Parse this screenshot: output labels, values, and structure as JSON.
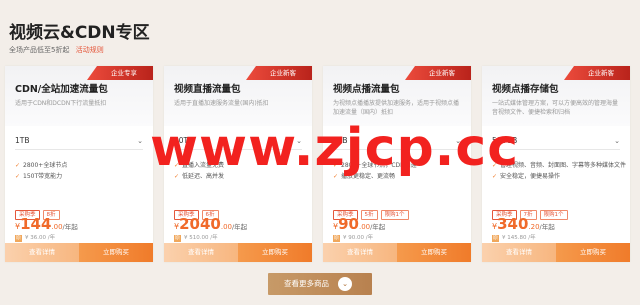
{
  "header": {
    "title": "视频云&CDN专区",
    "subtitle": "全场产品低至5折起",
    "rules_link": "活动规则"
  },
  "cards": [
    {
      "ribbon": "企业专享",
      "title": "CDN/全站加速流量包",
      "desc": "适用于CDN和DCDN下行流量抵扣",
      "spec": "1TB",
      "features": [
        "2800+全球节点",
        "150T带宽能力"
      ],
      "tags": [
        "采购季",
        "8折"
      ],
      "price_int": "144",
      "price_dec": ".00",
      "unit": "/年起",
      "orig_badge": "原",
      "orig": "¥ 36.00 /年",
      "detail_label": "查看详情",
      "buy_label": "立即购买"
    },
    {
      "ribbon": "企业新客",
      "title": "视频直播流量包",
      "desc": "适用于直播加速服务流量(国内)抵扣",
      "spec": "40TB",
      "features": [
        "直播入流量免费",
        "低延迟、高并发"
      ],
      "tags": [
        "采购季",
        "6折"
      ],
      "price_int": "2040",
      "price_dec": ".00",
      "unit": "/年起",
      "orig_badge": "原",
      "orig": "¥ 510.00 /年",
      "detail_label": "查看详情",
      "buy_label": "立即购买"
    },
    {
      "ribbon": "企业新客",
      "title": "视频点播流量包",
      "desc": "为视频点播播放提供加速服务，适用于视频点播加速流量（国内）抵扣",
      "spec": "1TB",
      "features": [
        "2800+全球节点，CDN加速",
        "播放更稳定、更流畅"
      ],
      "tags": [
        "采购季",
        "5折",
        "限购1个"
      ],
      "price_int": "90",
      "price_dec": ".00",
      "unit": "/年起",
      "orig_badge": "原",
      "orig": "¥ 90.00 /年",
      "detail_label": "查看详情",
      "buy_label": "立即购买"
    },
    {
      "ribbon": "企业新客",
      "title": "视频点播存储包",
      "desc": "一站式媒体管理方案，可以方便高效的管理海量音视频文件、便捷检索和归档",
      "spec": "500GB",
      "features": [
        "管理视频、音频、封面图、字幕等多种媒体文件",
        "安全稳定，便捷易操作"
      ],
      "tags": [
        "采购季",
        "7折",
        "限购1个"
      ],
      "price_int": "340",
      "price_dec": ".20",
      "unit": "/年起",
      "orig_badge": "原",
      "orig": "¥ 145.80 /年",
      "detail_label": "查看详情",
      "buy_label": "立即购买"
    }
  ],
  "more": {
    "label": "查看更多商品",
    "icon": "chevron-down-icon"
  },
  "watermark": "www.zjcp.cc",
  "colors": {
    "accent": "#f07b2a",
    "ribbon": "#d9342b",
    "more": "#b8814f",
    "watermark": "#f2221f"
  }
}
